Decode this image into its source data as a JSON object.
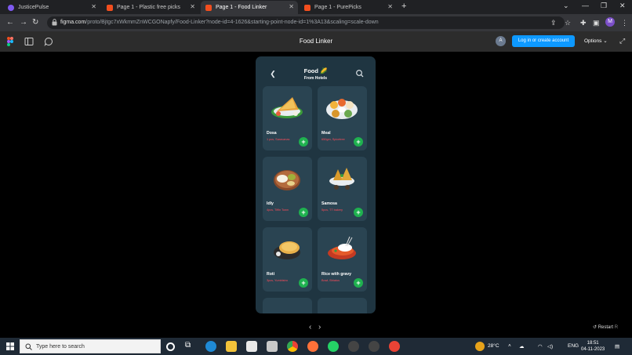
{
  "browser": {
    "tabs": [
      {
        "title": "JusticePulse",
        "color": "#7f5af0",
        "active": false
      },
      {
        "title": "Page 1 - Plastic free picks",
        "color": "#f24e1e",
        "active": false
      },
      {
        "title": "Page 1 - Food Linker",
        "color": "#f24e1e",
        "active": true
      },
      {
        "title": "Page 1 - PurePicks",
        "color": "#f24e1e",
        "active": false
      }
    ],
    "url_host": "figma.com",
    "url_path": "/proto/Bjtgc7xWkmmZnWCGONapfy/Food-Linker?node-id=4-1626&starting-point-node-id=1%3A13&scaling=scale-down",
    "profile_initial": "M"
  },
  "figma": {
    "title": "Food Linker",
    "avatar_initial": "A",
    "login_label": "Log in or create account",
    "options_label": "Options"
  },
  "app": {
    "title": "Food",
    "subtitle": "From Hotels",
    "items": [
      {
        "name": "Dosa",
        "desc": "1 pcs, Saravanas",
        "food": "dosa"
      },
      {
        "name": "Meal",
        "desc": "650gm, Spicetree",
        "food": "meal"
      },
      {
        "name": "Idly",
        "desc": "4pcs, Tiffin Town",
        "food": "idly"
      },
      {
        "name": "Samosa",
        "desc": "5pcs, TT bakery",
        "food": "samosa"
      },
      {
        "name": "Roti",
        "desc": "3pcs, Yumbistro",
        "food": "roti"
      },
      {
        "name": "Rice with gravy",
        "desc": "Bowl, Biriatus",
        "food": "rice"
      }
    ]
  },
  "canvas": {
    "prev_label": "‹",
    "next_label": "›",
    "restart_label": "Restart"
  },
  "taskbar": {
    "search_placeholder": "Type here to search",
    "weather": "28°C",
    "lang": "ENG",
    "time": "18:51",
    "date": "04-11-2023"
  }
}
